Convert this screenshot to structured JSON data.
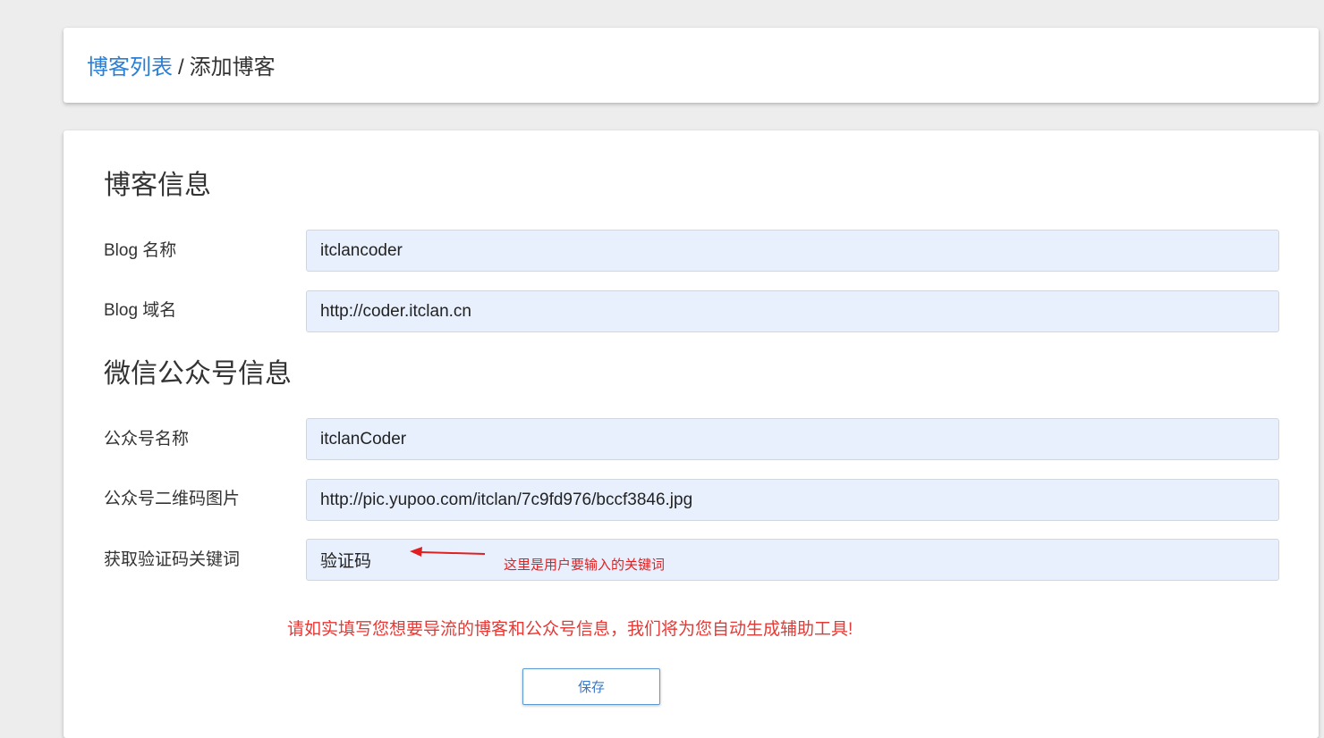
{
  "breadcrumb": {
    "parent": "博客列表",
    "separator": "/",
    "current": "添加博客"
  },
  "blog_section": {
    "title": "博客信息",
    "fields": [
      {
        "label": "Blog 名称",
        "value": "itclancoder"
      },
      {
        "label": "Blog 域名",
        "value": "http://coder.itclan.cn"
      }
    ]
  },
  "wechat_section": {
    "title": "微信公众号信息",
    "fields": [
      {
        "label": "公众号名称",
        "value": "itclanCoder"
      },
      {
        "label": "公众号二维码图片",
        "value": "http://pic.yupoo.com/itclan/7c9fd976/bccf3846.jpg"
      },
      {
        "label": "获取验证码关键词",
        "value": "验证码"
      }
    ]
  },
  "annotation": {
    "text": "这里是用户要输入的关键词",
    "color": "#e02020"
  },
  "notice": "请如实填写您想要导流的博客和公众号信息，我们将为您自动生成辅助工具!",
  "save_label": "保存",
  "colors": {
    "link": "#2a7fd4",
    "input_bg": "#e8f0fe",
    "notice": "#e53935",
    "button_text": "#3b78c4"
  }
}
